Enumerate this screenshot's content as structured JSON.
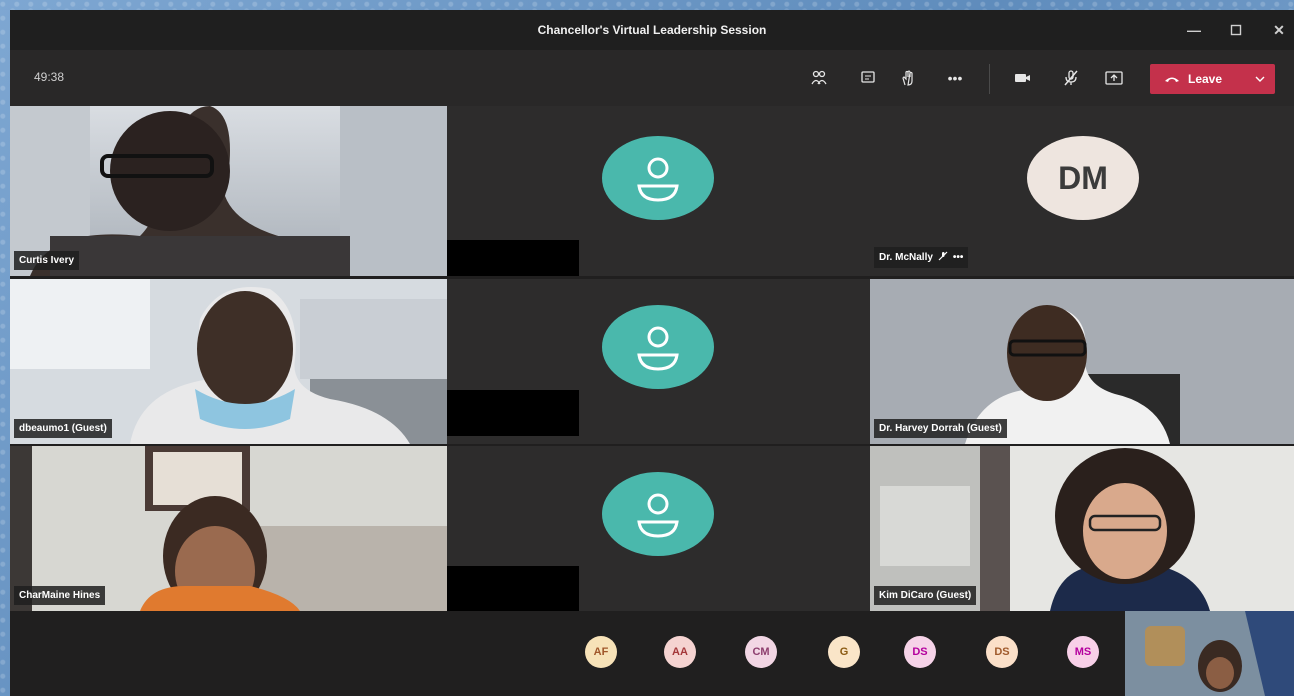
{
  "window": {
    "title": "Chancellor's Virtual Leadership Session",
    "controls": [
      "minimize-icon",
      "maximize-icon",
      "close-icon"
    ]
  },
  "toolbar": {
    "timer": "49:38",
    "icons": [
      "participants-icon",
      "chat-icon",
      "raise-hand-icon",
      "more-options-icon",
      "camera-icon",
      "mic-muted-icon",
      "share-screen-icon"
    ],
    "leave_label": "Leave",
    "leave_color": "#c4314b"
  },
  "participants": {
    "curtis": {
      "name": "Curtis Ivery"
    },
    "dbeaumo": {
      "name": "dbeaumo1 (Guest)"
    },
    "charmaine": {
      "name": "CharMaine Hines"
    },
    "mcnally": {
      "name": "Dr. McNally",
      "initials": "DM"
    },
    "dorrah": {
      "name": "Dr. Harvey Dorrah (Guest)"
    },
    "dicaro": {
      "name": "Kim DiCaro (Guest)"
    }
  },
  "avatar_color": "#4ab8ac",
  "overflow_avatars": [
    {
      "initials": "AF",
      "bg": "#f7e2b8",
      "fg": "#a0562a"
    },
    {
      "initials": "AA",
      "bg": "#f5d3d1",
      "fg": "#a4373a"
    },
    {
      "initials": "CM",
      "bg": "#f2d6e4",
      "fg": "#8d3e6e"
    },
    {
      "initials": "G",
      "bg": "#fae5c8",
      "fg": "#8a5a12"
    },
    {
      "initials": "DS",
      "bg": "#f6d3e8",
      "fg": "#b4009e"
    },
    {
      "initials": "DS",
      "bg": "#fbe0c9",
      "fg": "#a05a2c"
    },
    {
      "initials": "MS",
      "bg": "#f8d0e8",
      "fg": "#b4009e"
    }
  ]
}
